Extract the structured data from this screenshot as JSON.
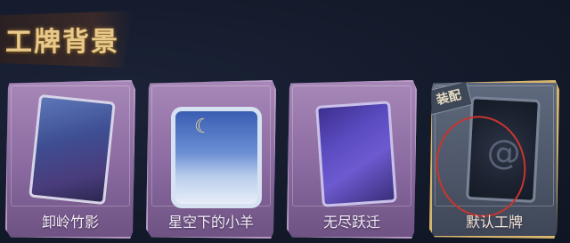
{
  "page": {
    "title": "工牌背景"
  },
  "cards": [
    {
      "name": "卸岭竹影",
      "selected": false
    },
    {
      "name": "星空下的小羊",
      "selected": false
    },
    {
      "name": "无尽跃迁",
      "selected": false
    },
    {
      "name": "默认工牌",
      "selected": true,
      "badge": "装配"
    }
  ],
  "colors": {
    "title": "#e9c98a",
    "card_purple": "#8a6aa0",
    "card_selected": "#4d5668",
    "selected_border": "#d8b56c",
    "mark_red": "#c7352f"
  }
}
